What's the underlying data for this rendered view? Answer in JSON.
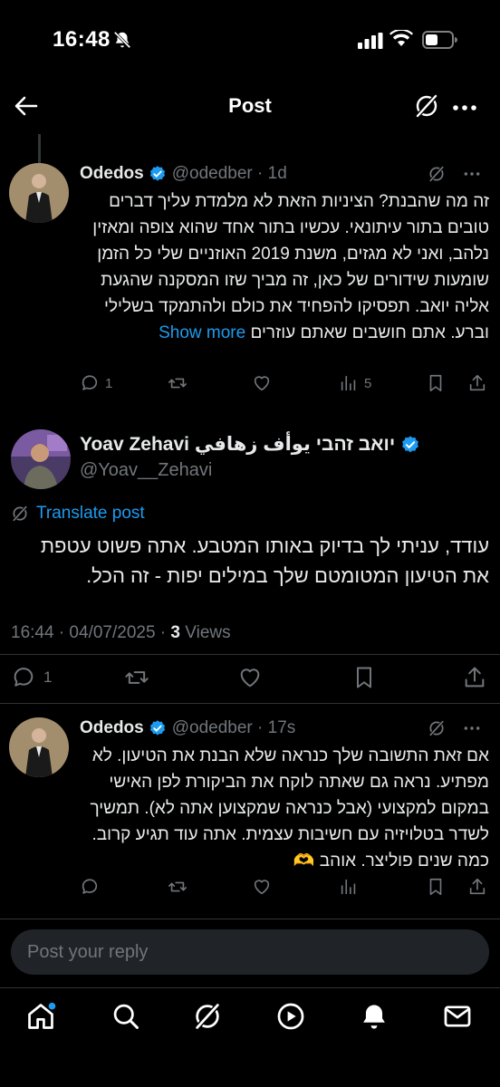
{
  "status_bar": {
    "time": "16:48"
  },
  "header": {
    "title": "Post"
  },
  "post_parent": {
    "author": "Odedos",
    "handle_time": "@odedber · 1d",
    "text": "זה מה שהבנת? הציניות הזאת לא מלמדת עליך דברים טובים בתור עיתונאי. עכשיו בתור אחד שהוא צופה ומאזין נלהב, ואני לא מגזים, משנת 2019 האוזניים שלי כל הזמן שומעות שידורים של כאן, זה מביך שזו המסקנה שהגעת אליה יואב. תפסיקו להפחיד את כולם ולהתמקד בשלילי וברע. אתם חושבים שאתם עוזרים",
    "show_more": "Show more",
    "replies": "1",
    "views": "5"
  },
  "post_main": {
    "author": "Yoav Zehavi יואב זהבי يوأف زهافي",
    "handle": "@Yoav__Zehavi",
    "translate": "Translate post",
    "text_lines": [
      "עודד, עניתי לך בדיוק באותו המטבע. אתה פשוט עטפת",
      "את הטיעון המטומטם שלך במילים יפות - זה הכל."
    ],
    "timestamp": "16:44 · 04/07/2025 · ",
    "views_count": "3",
    "views_label": " Views",
    "replies": "1"
  },
  "post_reply": {
    "author": "Odedos",
    "handle_time": "@odedber · 17s",
    "text": "אם זאת התשובה שלך כנראה שלא הבנת את הטיעון. לא מפתיע. נראה גם שאתה לוקח את הביקורת לפן האישי במקום למקצועי (אבל כנראה שמקצוען אתה לא). תמשיך לשדר בטלויזיה עם חשיבות עצמית. אתה עוד תגיע קרוב. כמה שנים פוליצר. אוהב 🫶"
  },
  "reply_bar": {
    "placeholder": "Post your reply"
  },
  "colors": {
    "accent": "#1d9bf0",
    "muted": "#71767b",
    "text": "#e7e9ea",
    "background": "#000000"
  },
  "icons": [
    "bell-slash-icon",
    "signal-icon",
    "wifi-icon",
    "battery-icon",
    "back-arrow-icon",
    "grok-icon",
    "more-icon",
    "verified-icon",
    "reply-icon",
    "repost-icon",
    "like-icon",
    "views-icon",
    "bookmark-icon",
    "share-icon",
    "translate-icon",
    "home-icon",
    "search-icon",
    "play-icon",
    "notifications-icon",
    "messages-icon"
  ]
}
